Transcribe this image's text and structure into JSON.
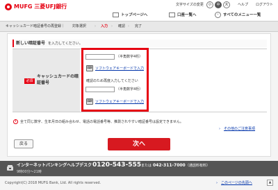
{
  "header": {
    "brand": "MUFG 三菱UFJ銀行",
    "text_size_label": "文字サイズの変更",
    "text_size_options": [
      "小",
      "中",
      "大"
    ],
    "help_link": "ヘルプ",
    "logout_link": "ログアウト",
    "nav": {
      "top_page": "トップページへ",
      "deposit_list": "口座一覧へ",
      "all_menu": "すべてのメニュー一覧"
    }
  },
  "breadcrumb": {
    "title": "キャッシュカード暗証番号の再登録｜",
    "steps": [
      "対象選択",
      "入力",
      "確認",
      "完了"
    ],
    "separator": "›"
  },
  "section": {
    "title": "新しい暗証番号",
    "instruction": "を入力してください。"
  },
  "form": {
    "required_badge": "必須",
    "field_label_line1": "キャッシュカードの暗",
    "field_label_line2": "証番号",
    "digits_hint": "（半角数字4桁）",
    "software_keyboard_link": "ソフトウェアキーボードで入力",
    "confirm_instruction": "確認のため再度入力してください"
  },
  "notice": {
    "text": "全て同じ数字、生年月日の組み合わせ、電話の電話番号等、推測されやすい暗証番号は設定できません。",
    "other_notes_link": "その他のご注意事項"
  },
  "buttons": {
    "back": "戻る",
    "next": "次へ"
  },
  "footer": {
    "helpdesk": "インターネットバンキングヘルプデスク",
    "freephone": "0120-543-555",
    "alt_prefix": "または",
    "alt_phone": "042-311-7000",
    "alt_note": "（通話料有料）",
    "hours": "9時00分〜21時",
    "copyright": "Copyright(C) 2018 MUFG Bank, Ltd. All rights reserved.",
    "page_top_link": "このページの先頭へ"
  },
  "colors": {
    "brand_red": "#e60012",
    "next_button": "#d71920",
    "link_blue": "#0033aa",
    "footer_bar": "#555555"
  }
}
